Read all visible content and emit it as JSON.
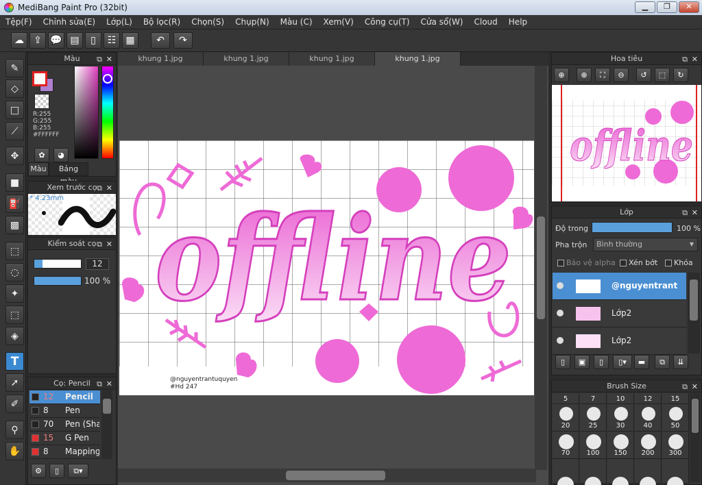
{
  "window": {
    "title": "MediBang Paint Pro (32bit)"
  },
  "menu": [
    "Tệp(F)",
    "Chỉnh sửa(E)",
    "Lớp(L)",
    "Bộ lọc(R)",
    "Chọn(S)",
    "Chụp(N)",
    "Màu (C)",
    "Xem(V)",
    "Công cụ(T)",
    "Cửa sổ(W)",
    "Cloud",
    "Help"
  ],
  "color_panel": {
    "title": "Màu",
    "r": "R:255",
    "g": "G:255",
    "b": "B:255",
    "hex": "#FFFFFF",
    "tab_color": "Màu",
    "tab_palette": "Bảng màu",
    "fg": "#e02020",
    "bg": "#ffffff"
  },
  "preview_panel": {
    "title": "Xem trước cọ",
    "size": "4.23mm"
  },
  "brush_control": {
    "title": "Kiểm soát cọ",
    "size": "12",
    "opacity": "100 %",
    "size_fraction": 0.18,
    "opacity_fraction": 1.0
  },
  "brush_list": {
    "title": "Cọ: Pencil",
    "items": [
      {
        "size": "12",
        "name": "Pencil",
        "color": "#222",
        "active": true
      },
      {
        "size": "8",
        "name": "Pen",
        "color": "#222"
      },
      {
        "size": "70",
        "name": "Pen (Sha",
        "color": "#222"
      },
      {
        "size": "15",
        "name": "G Pen",
        "color": "#e03030"
      },
      {
        "size": "8",
        "name": "Mapping P",
        "color": "#e03030"
      }
    ]
  },
  "tabs": [
    "khung 1.jpg",
    "khung 1.jpg",
    "khung 1.jpg",
    "khung 1.jpg"
  ],
  "artwork": {
    "main_text": "offline",
    "credit_line1": "@nguyentrantuquyen",
    "credit_line2": "#Hd 247",
    "pink": "#ee6ad6"
  },
  "navigator": {
    "title": "Hoa tiêu",
    "main_text": "offline"
  },
  "layers": {
    "title": "Lớp",
    "opacity_label": "Độ trong",
    "opacity_value": "100 %",
    "blend_label": "Pha trộn",
    "blend_value": "Bình thường",
    "protect_alpha": "Bảo vệ alpha",
    "clipping": "Xén bớt",
    "lock": "Khóa",
    "items": [
      {
        "name": "@nguyentrant",
        "selected": true
      },
      {
        "name": "Lớp2"
      },
      {
        "name": "Lớp2"
      }
    ]
  },
  "brush_size": {
    "title": "Brush Size",
    "top": [
      "5",
      "7",
      "10",
      "12",
      "15"
    ],
    "rows": [
      [
        "20",
        "25",
        "30",
        "40",
        "50"
      ],
      [
        "70",
        "100",
        "150",
        "200",
        "300"
      ]
    ]
  }
}
